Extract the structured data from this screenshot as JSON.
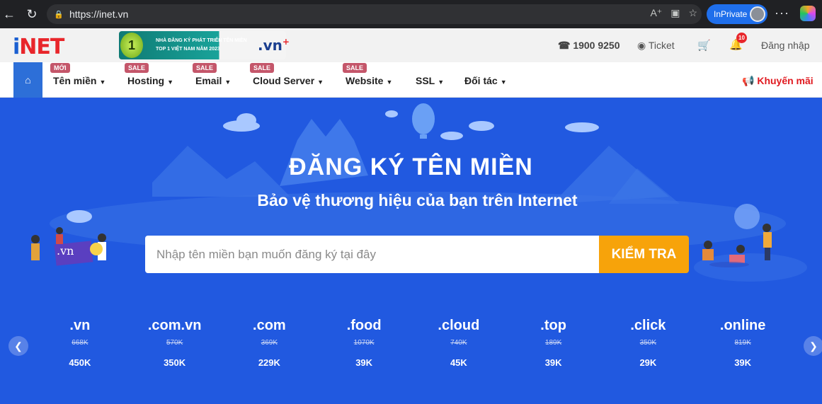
{
  "browser": {
    "url": "https://inet.vn",
    "inprivate_label": "InPrivate",
    "more_label": "···"
  },
  "header": {
    "logo_i": "i",
    "logo_net": "NET",
    "banner_medal": "1",
    "banner_text": "NHÀ ĐĂNG KÝ PHÁT TRIỂN TÊN MIỀN TOP 1 VIỆT NAM NĂM 2023",
    "banner_vn": ".vn",
    "hotline": "1900 9250",
    "ticket": "Ticket",
    "notif_count": "10",
    "login": "Đăng nhập"
  },
  "nav": {
    "items": [
      {
        "label": "Tên miền",
        "tag": "MỚI"
      },
      {
        "label": "Hosting",
        "tag": "SALE"
      },
      {
        "label": "Email",
        "tag": "SALE"
      },
      {
        "label": "Cloud Server",
        "tag": "SALE"
      },
      {
        "label": "Website",
        "tag": "SALE"
      },
      {
        "label": "SSL",
        "tag": ""
      },
      {
        "label": "Đối tác",
        "tag": ""
      }
    ],
    "promo": "Khuyến mãi"
  },
  "hero": {
    "title": "ĐĂNG KÝ TÊN MIỀN",
    "subtitle": "Bảo vệ thương hiệu của bạn trên Internet",
    "search_placeholder": "Nhập tên miền bạn muốn đăng ký tại đây",
    "search_button": "KIỂM TRA",
    "illustration_label": ".vn"
  },
  "tlds": [
    {
      "ext": ".vn",
      "old": "668K",
      "new": "450K"
    },
    {
      "ext": ".com.vn",
      "old": "570K",
      "new": "350K"
    },
    {
      "ext": ".com",
      "old": "369K",
      "new": "229K"
    },
    {
      "ext": ".food",
      "old": "1070K",
      "new": "39K"
    },
    {
      "ext": ".cloud",
      "old": "740K",
      "new": "45K"
    },
    {
      "ext": ".top",
      "old": "189K",
      "new": "39K"
    },
    {
      "ext": ".click",
      "old": "350K",
      "new": "29K"
    },
    {
      "ext": ".online",
      "old": "819K",
      "new": "39K"
    }
  ],
  "colors": {
    "hero_bg": "#2159e0",
    "brand_blue": "#1b5fd1",
    "brand_red": "#e8262b",
    "cta_orange": "#f7a30a",
    "sale_tag": "#c4566a"
  }
}
